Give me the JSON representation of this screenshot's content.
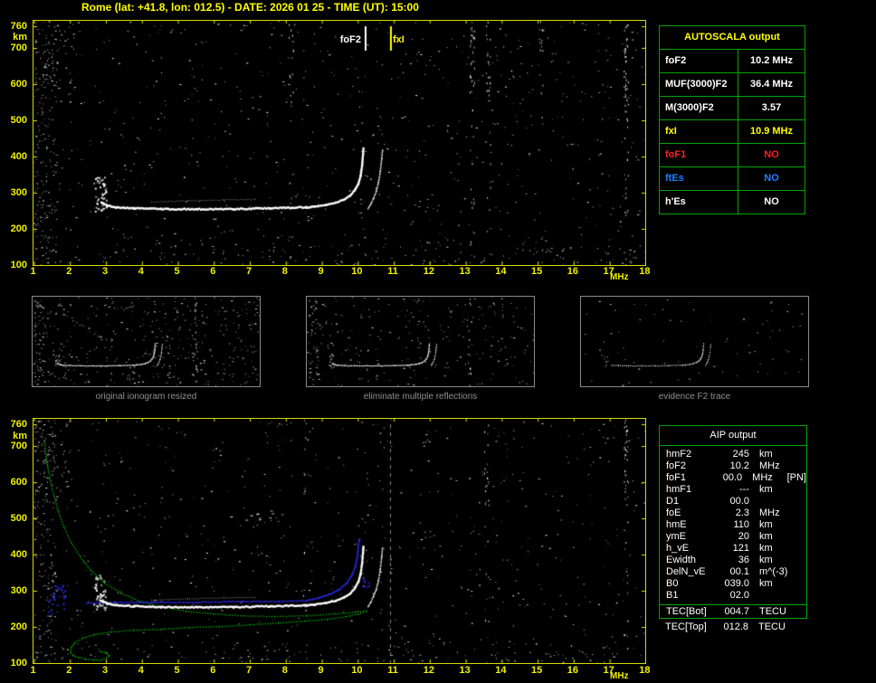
{
  "header": {
    "title": "Rome (lat: +41.8, lon: 012.5) - DATE: 2026 01 25 - TIME (UT): 15:00"
  },
  "axes": {
    "y_unit": "km",
    "x_unit": "MHz",
    "y_ticks": [
      "760",
      "700",
      "600",
      "500",
      "400",
      "300",
      "200",
      "100"
    ],
    "x_ticks": [
      "1",
      "2",
      "3",
      "4",
      "5",
      "6",
      "7",
      "8",
      "9",
      "10",
      "11",
      "12",
      "13",
      "14",
      "15",
      "16",
      "17",
      "18"
    ]
  },
  "top_plot": {
    "markers": {
      "fof2_label": "foF2",
      "fof2_mhz": 10.2,
      "fxi_label": "fxI",
      "fxi_mhz": 10.9
    }
  },
  "autoscala": {
    "title": "AUTOSCALA output",
    "rows": [
      {
        "label": "foF2",
        "value": "10.2 MHz",
        "color": "#ffffff"
      },
      {
        "label": "MUF(3000)F2",
        "value": "36.4 MHz",
        "color": "#ffffff"
      },
      {
        "label": "M(3000)F2",
        "value": "3.57",
        "color": "#ffffff"
      },
      {
        "label": "fxI",
        "value": "10.9 MHz",
        "color": "#ffff00"
      },
      {
        "label": "foF1",
        "value": "NO",
        "color": "#ff2020"
      },
      {
        "label": "ftEs",
        "value": "NO",
        "color": "#1f7fff"
      },
      {
        "label": "h'Es",
        "value": "NO",
        "color": "#ffffff"
      }
    ]
  },
  "thumbnails": [
    {
      "caption": "original ionogram resized"
    },
    {
      "caption": "eliminate multiple reflections"
    },
    {
      "caption": "evidence F2 trace"
    }
  ],
  "aip": {
    "title": "AIP output",
    "rows": [
      {
        "label": "hmF2",
        "value": "245",
        "unit": "km",
        "note": ""
      },
      {
        "label": "foF2",
        "value": "10.2",
        "unit": "MHz",
        "note": ""
      },
      {
        "label": "foF1",
        "value": "00.0",
        "unit": "MHz",
        "note": "[PN]"
      },
      {
        "label": "hmF1",
        "value": "---",
        "unit": "km",
        "note": ""
      },
      {
        "label": "D1",
        "value": "00.0",
        "unit": "",
        "note": ""
      },
      {
        "label": "foE",
        "value": "2.3",
        "unit": "MHz",
        "note": ""
      },
      {
        "label": "hmE",
        "value": "110",
        "unit": "km",
        "note": ""
      },
      {
        "label": "ymE",
        "value": "20",
        "unit": "km",
        "note": ""
      },
      {
        "label": "h_vE",
        "value": "121",
        "unit": "km",
        "note": ""
      },
      {
        "label": "Ewidth",
        "value": "36",
        "unit": "km",
        "note": ""
      },
      {
        "label": "DelN_vE",
        "value": "00.1",
        "unit": "m^(-3)",
        "note": ""
      },
      {
        "label": "B0",
        "value": "039.0",
        "unit": "km",
        "note": ""
      },
      {
        "label": "B1",
        "value": "02.0",
        "unit": "",
        "note": ""
      }
    ],
    "tec_rows": [
      {
        "label": "TEC[Bot]",
        "value": "004.7",
        "unit": "TECU"
      },
      {
        "label": "TEC[Top]",
        "value": "012.8",
        "unit": "TECU"
      }
    ]
  },
  "chart_data": [
    {
      "type": "scatter",
      "title": "ionogram (virtual height vs frequency)",
      "xlabel": "MHz",
      "ylabel": "km",
      "xlim": [
        1,
        18
      ],
      "ylim": [
        100,
        760
      ],
      "annotations": [
        "foF2 line at 10.2 MHz",
        "fxI line at 10.9 MHz",
        "F2 O-mode trace flat near 250 km from ~2.8 to ~8.9 MHz, cusp rising to ~400 km near 10.2 MHz",
        "X-mode branch near 10.4-10.8 MHz"
      ]
    },
    {
      "type": "scatter",
      "title": "ionogram with AIP inversion (green electron density profile, blue restored trace)",
      "xlabel": "MHz",
      "ylabel": "km",
      "xlim": [
        1,
        18
      ],
      "ylim": [
        100,
        760
      ],
      "annotations": [
        "green N(h) profile: topside from ~700 km down to peak hmF2 245 km at 10.2 MHz, bottomside to E layer (foE 2.3 MHz at 110 km)",
        "blue fitted trace overlays white measured trace",
        "dashed vertical line near 10.9 MHz"
      ]
    }
  ],
  "colors": {
    "axis": "#e8e800",
    "title": "#ffff00",
    "table_border": "#00a400",
    "caption": "#8f8f8f",
    "trace_white": "#ffffff",
    "profile_green": "#00b400",
    "trace_blue": "#2828e8"
  }
}
